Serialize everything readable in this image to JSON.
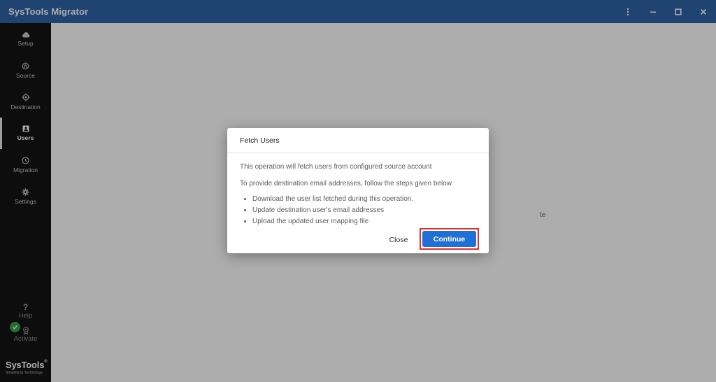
{
  "window": {
    "title": "SysTools Migrator",
    "controls": [
      "more-vertical-icon",
      "minimize-icon",
      "maximize-icon",
      "close-icon"
    ]
  },
  "sidebar": {
    "items": [
      {
        "label": "Setup",
        "icon": "cloud-icon",
        "active": false
      },
      {
        "label": "Source",
        "icon": "source-icon",
        "active": false
      },
      {
        "label": "Destination",
        "icon": "target-icon",
        "active": false
      },
      {
        "label": "Users",
        "icon": "user-card-icon",
        "active": true
      },
      {
        "label": "Migration",
        "icon": "clock-icon",
        "active": false
      },
      {
        "label": "Settings",
        "icon": "gear-icon",
        "active": false
      }
    ],
    "help_label": "Help",
    "activate_label": "Activate",
    "brand_name": "SysTools",
    "brand_reg": "®",
    "brand_tagline": "Simplifying Technology"
  },
  "main": {
    "partial_text": "te"
  },
  "dialog": {
    "title": "Fetch Users",
    "line1": "This operation will fetch users from configured source account",
    "line2": "To provide destination email addresses, follow the steps given below",
    "steps": [
      "Download the user list fetched during this operation.",
      "Update destination user's email addresses",
      "Upload the updated user mapping file"
    ],
    "close_label": "Close",
    "continue_label": "Continue"
  },
  "colors": {
    "titlebar": "#2f65a7",
    "sidebar": "#141414",
    "primary_button": "#1e6fd6",
    "highlight_border": "#e03030",
    "activated_check": "#34a34a"
  }
}
